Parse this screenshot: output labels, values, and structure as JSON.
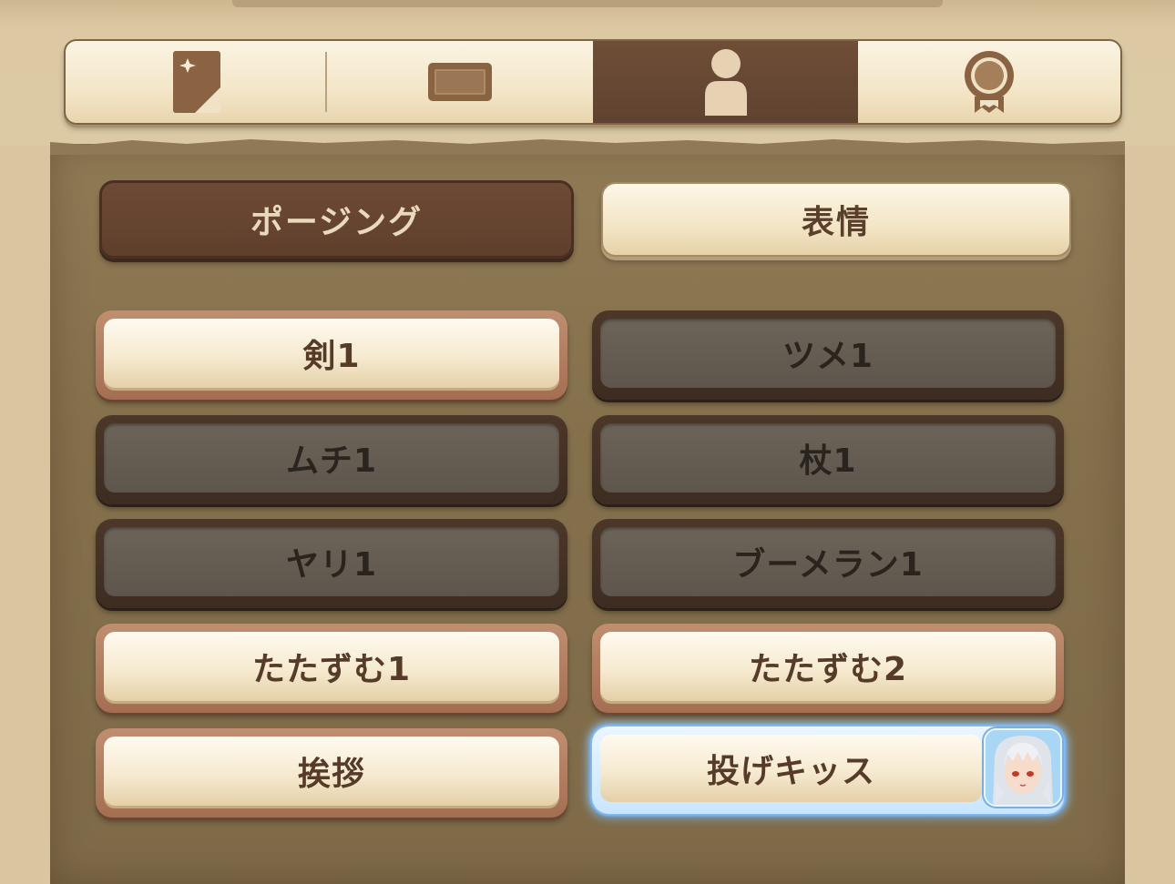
{
  "tabs": [
    {
      "icon": "card-icon",
      "active": false
    },
    {
      "icon": "frame-icon",
      "active": false
    },
    {
      "icon": "person-icon",
      "active": true
    },
    {
      "icon": "medal-icon",
      "active": false
    }
  ],
  "subtabs": {
    "posing": "ポージング",
    "expression": "表情",
    "active": "posing"
  },
  "poses": [
    {
      "label": "剣1",
      "state": "unlocked"
    },
    {
      "label": "ツメ1",
      "state": "locked"
    },
    {
      "label": "ムチ1",
      "state": "locked"
    },
    {
      "label": "杖1",
      "state": "locked"
    },
    {
      "label": "ヤリ1",
      "state": "locked"
    },
    {
      "label": "ブーメラン1",
      "state": "locked"
    },
    {
      "label": "たたずむ1",
      "state": "unlocked"
    },
    {
      "label": "たたずむ2",
      "state": "unlocked"
    },
    {
      "label": "挨拶",
      "state": "unlocked"
    },
    {
      "label": "投げキッス",
      "state": "selected"
    }
  ],
  "colors": {
    "active_tab": "#6f4e37",
    "selected_glow": "#8ec6ff",
    "locked_fill": "#5e564c",
    "unlocked_fill": "#f6ead0"
  }
}
